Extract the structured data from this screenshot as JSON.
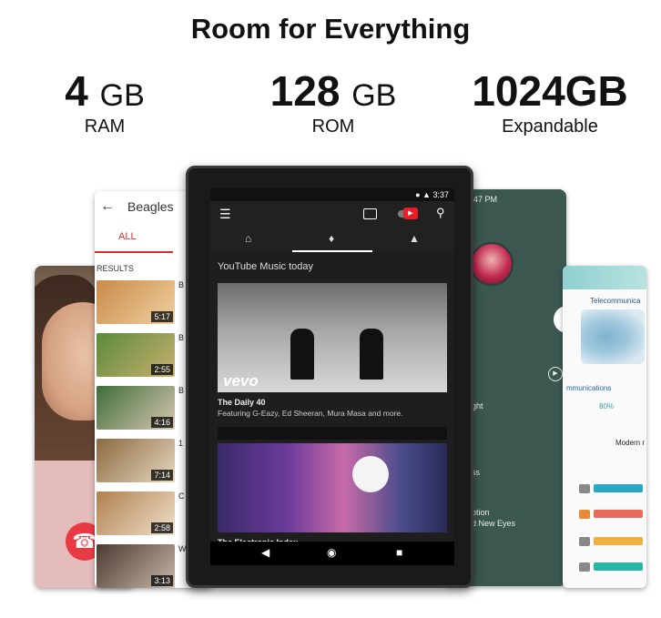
{
  "headline": "Room for Everything",
  "specs": [
    {
      "value": "4",
      "unit": "GB",
      "label": "RAM"
    },
    {
      "value": "128",
      "unit": "GB",
      "label": "ROM"
    },
    {
      "value": "1024GB",
      "unit": "",
      "label": "Expandable"
    }
  ],
  "search_device": {
    "query": "Beagles",
    "tab_all": "ALL",
    "results_label": "RESULTS",
    "durations": [
      "5:17",
      "2:55",
      "4:16",
      "7:14",
      "2:58",
      "3:13"
    ],
    "title_letters": [
      "B",
      "B",
      "B",
      "1",
      "C",
      "W"
    ]
  },
  "main_device": {
    "status_time": "3:37",
    "section_title": "YouTube Music today",
    "card1": {
      "badge": "vevo",
      "title": "The Daily 40",
      "subtitle": "Featuring G-Eazy, Ed Sheeran, Mura Masa and more."
    },
    "card2": {
      "title": "The Electronic Index"
    }
  },
  "green_device": {
    "time": "47 PM",
    "text_lines": [
      "ght",
      "ss",
      "ption",
      "d New Eyes"
    ]
  },
  "info_device": {
    "title": "Telecommunica",
    "subtitle": "mmunications",
    "percent": "80%",
    "modern": "Modern r"
  },
  "colors": {
    "youtube_red": "#ea1c24",
    "search_red": "#d32f2f",
    "green_bg": "#3b5750",
    "hangup": "#e83a44"
  }
}
